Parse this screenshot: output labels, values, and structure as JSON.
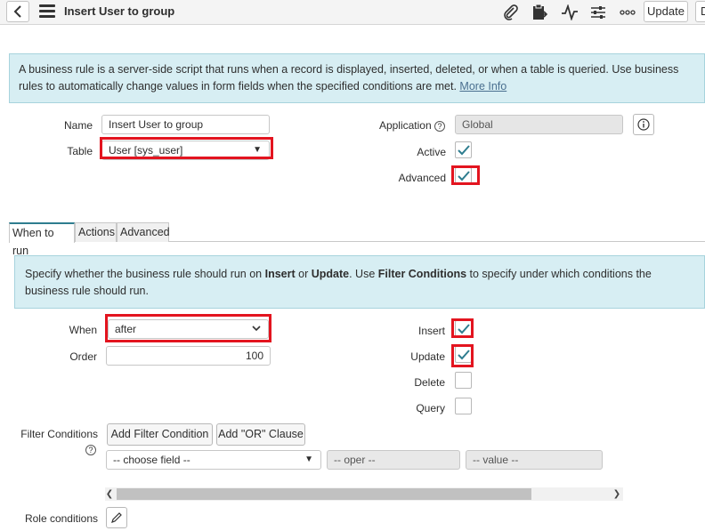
{
  "header": {
    "title": "Insert User to group",
    "update_label": "Update",
    "delete_label_partial": "D",
    "icons": [
      "back-icon",
      "hamburger-icon",
      "paperclip-icon",
      "clipboard-icon",
      "activity-icon",
      "sliders-icon",
      "more-icon"
    ]
  },
  "info": {
    "text": "A business rule is a server-side script that runs when a record is displayed, inserted, deleted, or when a table is queried. Use business rules to automatically change values in form fields when the specified conditions are met.",
    "link": "More Info"
  },
  "form": {
    "name_label": "Name",
    "name_value": "Insert User to group",
    "table_label": "Table",
    "table_value": "User [sys_user]",
    "application_label": "Application",
    "application_value": "Global",
    "active_label": "Active",
    "advanced_label": "Advanced"
  },
  "tabs": [
    {
      "label": "When to run"
    },
    {
      "label": "Actions"
    },
    {
      "label": "Advanced"
    }
  ],
  "when_to_run": {
    "info_pre": "Specify whether the business rule should run on ",
    "info_insert": "Insert",
    "info_or": " or ",
    "info_update": "Update",
    "info_use": ". Use ",
    "info_filter": "Filter Conditions",
    "info_post": " to specify under which conditions the business rule should run.",
    "when_label": "When",
    "when_value": "after",
    "order_label": "Order",
    "order_value": "100",
    "insert_label": "Insert",
    "update_label": "Update",
    "delete_label": "Delete",
    "query_label": "Query",
    "filter_label": "Filter Conditions",
    "add_filter_label": "Add Filter Condition",
    "add_or_label": "Add \"OR\" Clause",
    "choose_field": "-- choose field --",
    "oper": "-- oper --",
    "value": "-- value --",
    "role_label": "Role conditions"
  },
  "colors": {
    "accent": "#2e7d8f",
    "highlight": "#e3141f",
    "info_bg": "#d7eef3",
    "check": "#2e7d8f"
  }
}
